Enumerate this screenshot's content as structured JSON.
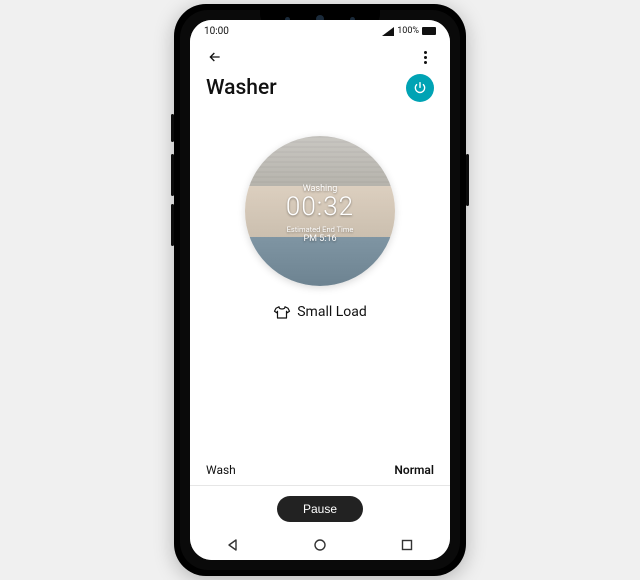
{
  "statusbar": {
    "time": "10:00",
    "battery_text": "100%"
  },
  "header": {
    "title": "Washer"
  },
  "cycle": {
    "status_label": "Washing",
    "remaining": "00:32",
    "estimated_end_label": "Estimated End Time",
    "estimated_end_value": "PM 5:16",
    "load_label": "Small Load"
  },
  "options": {
    "left": "Wash",
    "right": "Normal"
  },
  "actions": {
    "pause": "Pause"
  },
  "colors": {
    "accent": "#00a3b4",
    "action_dark": "#222222"
  }
}
